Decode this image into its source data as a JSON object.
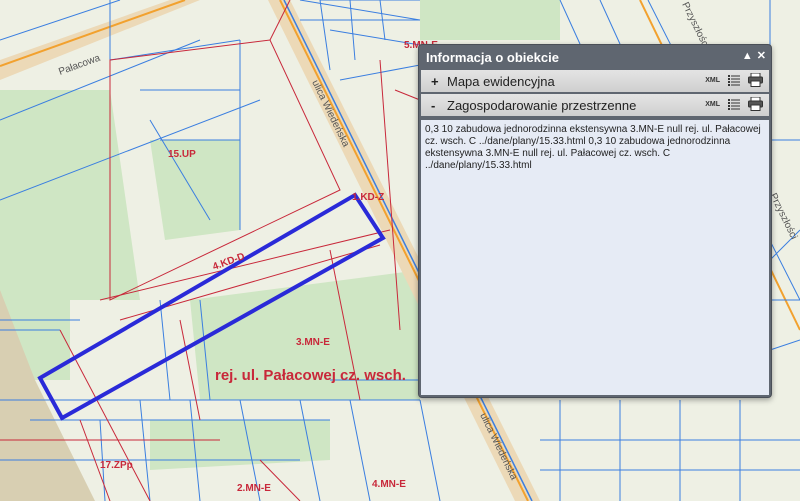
{
  "map": {
    "labels": {
      "mn_top": "5.MN-E",
      "up": "15.UP",
      "kd_z": "1.KD-Z",
      "kd_d": "4.KD-D",
      "mn_center": "3.MN-E",
      "street_big": "rej. ul. Pałacowej cz. wsch.",
      "zpp": "17.ZPp",
      "mn_bottom_left": "2.MN-E",
      "mn_bottom_right": "4.MN-E"
    },
    "streets": {
      "palacowa": "Pałacowa",
      "wiedenska_top": "ulica Wiedeńska",
      "wiedenska_bottom": "ulica Wiedeńska",
      "right_top": "Przyszłości",
      "right_mid": "Przyszłości"
    },
    "colors": {
      "parcel_blue": "#3a7ee0",
      "zone_red": "#c8283a",
      "selection": "#2a2ad8",
      "road_orange": "#f2a12e"
    }
  },
  "panel": {
    "title": "Informacja o obiekcie",
    "minimize_label": "▲",
    "close_label": "✕",
    "sections": [
      {
        "toggle": "+",
        "label": "Mapa ewidencyjna",
        "xml": "XML"
      },
      {
        "toggle": "-",
        "label": "Zagospodarowanie przestrzenne",
        "xml": "XML"
      }
    ],
    "content_text": "0,3 10 zabudowa jednorodzinna ekstensywna 3.MN-E null rej. ul. Pałacowej cz. wsch. C ../dane/plany/15.33.html 0,3 10 zabudowa jednorodzinna ekstensywna 3.MN-E null rej. ul. Pałacowej cz. wsch. C ../dane/plany/15.33.html"
  }
}
